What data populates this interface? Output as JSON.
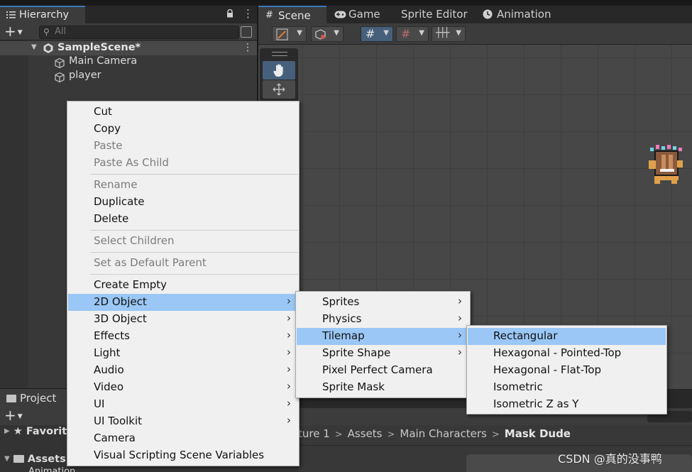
{
  "hierarchy": {
    "tab_label": "Hierarchy",
    "search_placeholder": "All",
    "scene_name": "SampleScene*",
    "items": [
      "Main Camera",
      "player"
    ]
  },
  "scene_tabs": [
    "Scene",
    "Game",
    "Sprite Editor",
    "Animation"
  ],
  "context_menu": {
    "items": [
      {
        "label": "Cut",
        "enabled": true
      },
      {
        "label": "Copy",
        "enabled": true
      },
      {
        "label": "Paste",
        "enabled": false
      },
      {
        "label": "Paste As Child",
        "enabled": false
      },
      {
        "label": "Rename",
        "enabled": false
      },
      {
        "label": "Duplicate",
        "enabled": true
      },
      {
        "label": "Delete",
        "enabled": true
      },
      {
        "label": "Select Children",
        "enabled": false
      },
      {
        "label": "Set as Default Parent",
        "enabled": false
      },
      {
        "label": "Create Empty",
        "enabled": true
      },
      {
        "label": "2D Object",
        "enabled": true,
        "submenu": true,
        "highlighted": true
      },
      {
        "label": "3D Object",
        "enabled": true,
        "submenu": true
      },
      {
        "label": "Effects",
        "enabled": true,
        "submenu": true
      },
      {
        "label": "Light",
        "enabled": true,
        "submenu": true
      },
      {
        "label": "Audio",
        "enabled": true,
        "submenu": true
      },
      {
        "label": "Video",
        "enabled": true,
        "submenu": true
      },
      {
        "label": "UI",
        "enabled": true,
        "submenu": true
      },
      {
        "label": "UI Toolkit",
        "enabled": true,
        "submenu": true
      },
      {
        "label": "Camera",
        "enabled": true
      },
      {
        "label": "Visual Scripting Scene Variables",
        "enabled": true
      }
    ]
  },
  "submenu_2d": {
    "items": [
      {
        "label": "Sprites",
        "submenu": true
      },
      {
        "label": "Physics",
        "submenu": true
      },
      {
        "label": "Tilemap",
        "submenu": true,
        "highlighted": true
      },
      {
        "label": "Sprite Shape",
        "submenu": true
      },
      {
        "label": "Pixel Perfect Camera"
      },
      {
        "label": "Sprite Mask"
      }
    ]
  },
  "submenu_tilemap": {
    "items": [
      {
        "label": "Rectangular",
        "highlighted": true
      },
      {
        "label": "Hexagonal - Pointed-Top"
      },
      {
        "label": "Hexagonal - Flat-Top"
      },
      {
        "label": "Isometric"
      },
      {
        "label": "Isometric Z as Y"
      }
    ]
  },
  "project": {
    "tab_label": "Project",
    "favorites_label": "Favorit",
    "assets_label": "Assets",
    "animation_label": "Animation",
    "breadcrumb": [
      "ture 1",
      "Assets",
      "Main Characters",
      "Mask Dude"
    ]
  },
  "watermark": "CSDN @真的没事鸭",
  "colors": {
    "highlight": "#9ac7f5",
    "menu_bg": "#f0f0f0",
    "disabled_text": "#7c7c7c",
    "tab_accent": "#3a79bb"
  }
}
